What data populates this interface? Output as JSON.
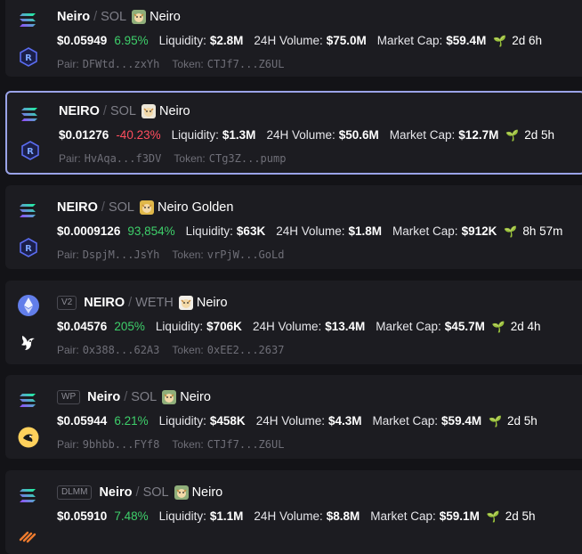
{
  "pairs": [
    {
      "chain": "solana",
      "dex": "raydium",
      "badge": "",
      "base": "Neiro",
      "quote": "SOL",
      "name": "Neiro",
      "price": "$0.05949",
      "change": "6.95%",
      "change_dir": "up",
      "liq_label": "Liquidity:",
      "liq": "$2.8M",
      "vol_label": "24H Volume:",
      "vol": "$75.0M",
      "mcap_label": "Market Cap:",
      "mcap": "$59.4M",
      "age": "2d 6h",
      "pair_label": "Pair:",
      "pair": "DFWtd...zxYh",
      "token_label": "Token:",
      "token": "CTJf7...Z6UL",
      "selected": false
    },
    {
      "chain": "solana",
      "dex": "raydium",
      "badge": "",
      "base": "NEIRO",
      "quote": "SOL",
      "name": "Neiro",
      "price": "$0.01276",
      "change": "-40.23%",
      "change_dir": "down",
      "liq_label": "Liquidity:",
      "liq": "$1.3M",
      "vol_label": "24H Volume:",
      "vol": "$50.6M",
      "mcap_label": "Market Cap:",
      "mcap": "$12.7M",
      "age": "2d 5h",
      "pair_label": "Pair:",
      "pair": "HvAqa...f3DV",
      "token_label": "Token:",
      "token": "CTg3Z...pump",
      "selected": true
    },
    {
      "chain": "solana",
      "dex": "raydium",
      "badge": "",
      "base": "NEIRO",
      "quote": "SOL",
      "name": "Neiro Golden",
      "price": "$0.0009126",
      "change": "93,854%",
      "change_dir": "up",
      "liq_label": "Liquidity:",
      "liq": "$63K",
      "vol_label": "24H Volume:",
      "vol": "$1.8M",
      "mcap_label": "Market Cap:",
      "mcap": "$912K",
      "age": "8h 57m",
      "pair_label": "Pair:",
      "pair": "DspjM...JsYh",
      "token_label": "Token:",
      "token": "vrPjW...GoLd",
      "selected": false
    },
    {
      "chain": "ethereum",
      "dex": "uniswap",
      "badge": "V2",
      "base": "NEIRO",
      "quote": "WETH",
      "name": "Neiro",
      "price": "$0.04576",
      "change": "205%",
      "change_dir": "up",
      "liq_label": "Liquidity:",
      "liq": "$706K",
      "vol_label": "24H Volume:",
      "vol": "$13.4M",
      "mcap_label": "Market Cap:",
      "mcap": "$45.7M",
      "age": "2d 4h",
      "pair_label": "Pair:",
      "pair": "0x388...62A3",
      "token_label": "Token:",
      "token": "0xEE2...2637",
      "selected": false
    },
    {
      "chain": "solana",
      "dex": "orca",
      "badge": "WP",
      "base": "Neiro",
      "quote": "SOL",
      "name": "Neiro",
      "price": "$0.05944",
      "change": "6.21%",
      "change_dir": "up",
      "liq_label": "Liquidity:",
      "liq": "$458K",
      "vol_label": "24H Volume:",
      "vol": "$4.3M",
      "mcap_label": "Market Cap:",
      "mcap": "$59.4M",
      "age": "2d 5h",
      "pair_label": "Pair:",
      "pair": "9bhbb...FYf8",
      "token_label": "Token:",
      "token": "CTJf7...Z6UL",
      "selected": false
    },
    {
      "chain": "solana",
      "dex": "meteora",
      "badge": "DLMM",
      "base": "Neiro",
      "quote": "SOL",
      "name": "Neiro",
      "price": "$0.05910",
      "change": "7.48%",
      "change_dir": "up",
      "liq_label": "Liquidity:",
      "liq": "$1.1M",
      "vol_label": "24H Volume:",
      "vol": "$8.8M",
      "mcap_label": "Market Cap:",
      "mcap": "$59.1M",
      "age": "2d 5h",
      "pair_label": "Pair:",
      "pair": "",
      "token_label": "Token:",
      "token": "",
      "selected": false
    }
  ],
  "colors": {
    "up": "#3ecf6a",
    "down": "#ff4d5e",
    "selected_border": "#9aa3e8",
    "card_bg": "#1c1c21",
    "page_bg": "#131317"
  }
}
